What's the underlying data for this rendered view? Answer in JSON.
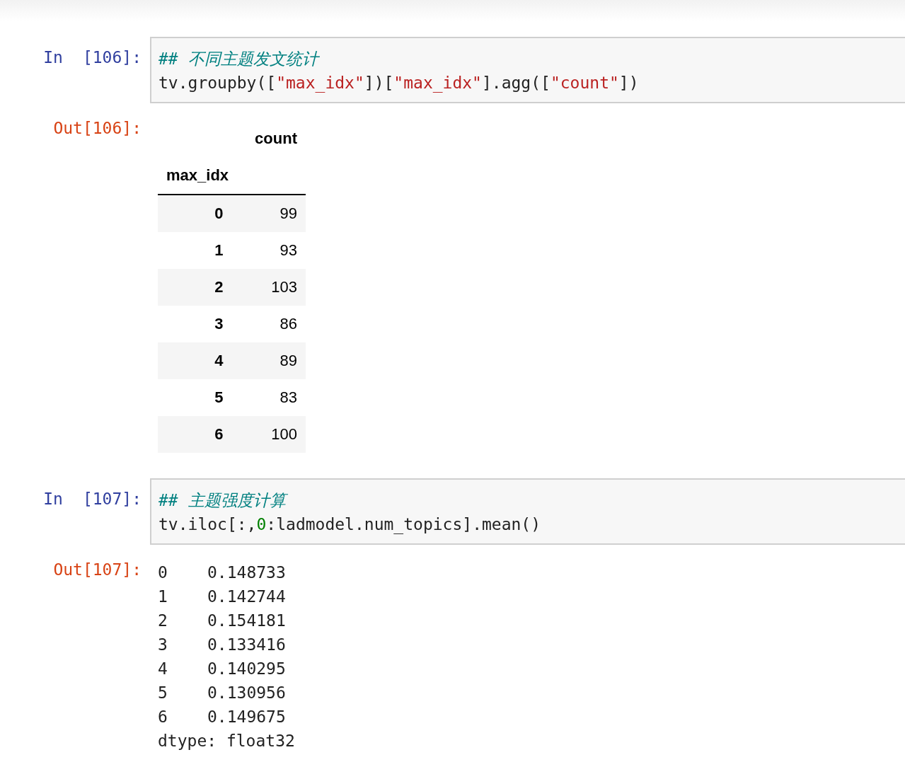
{
  "cells": [
    {
      "kind": "input",
      "prompt_label": "In",
      "prompt_number": "[106]:",
      "lines": [
        [
          {
            "kind": "comment",
            "text": "## 不同主题发文统计"
          }
        ],
        [
          {
            "kind": "plain",
            "text": "tv.groupby(["
          },
          {
            "kind": "string",
            "text": "\"max_idx\""
          },
          {
            "kind": "plain",
            "text": "])["
          },
          {
            "kind": "string",
            "text": "\"max_idx\""
          },
          {
            "kind": "plain",
            "text": "].agg(["
          },
          {
            "kind": "string",
            "text": "\"count\""
          },
          {
            "kind": "plain",
            "text": "])"
          }
        ]
      ]
    },
    {
      "kind": "table",
      "prompt": "Out[106]:",
      "column": "count",
      "index_name": "max_idx",
      "rows": [
        {
          "index": "0",
          "value": "99"
        },
        {
          "index": "1",
          "value": "93"
        },
        {
          "index": "2",
          "value": "103"
        },
        {
          "index": "3",
          "value": "86"
        },
        {
          "index": "4",
          "value": "89"
        },
        {
          "index": "5",
          "value": "83"
        },
        {
          "index": "6",
          "value": "100"
        }
      ]
    },
    {
      "kind": "input",
      "prompt_label": "In",
      "prompt_number": "[107]:",
      "lines": [
        [
          {
            "kind": "comment",
            "text": "## 主题强度计算"
          }
        ],
        [
          {
            "kind": "plain",
            "text": "tv.iloc[:,"
          },
          {
            "kind": "number",
            "text": "0"
          },
          {
            "kind": "plain",
            "text": ":ladmodel.num_topics].mean()"
          }
        ]
      ]
    },
    {
      "kind": "series",
      "prompt": "Out[107]:",
      "rows": [
        {
          "index": "0",
          "value": "0.148733"
        },
        {
          "index": "1",
          "value": "0.142744"
        },
        {
          "index": "2",
          "value": "0.154181"
        },
        {
          "index": "3",
          "value": "0.133416"
        },
        {
          "index": "4",
          "value": "0.140295"
        },
        {
          "index": "5",
          "value": "0.130956"
        },
        {
          "index": "6",
          "value": "0.149675"
        }
      ],
      "footer": "dtype: float32"
    }
  ]
}
